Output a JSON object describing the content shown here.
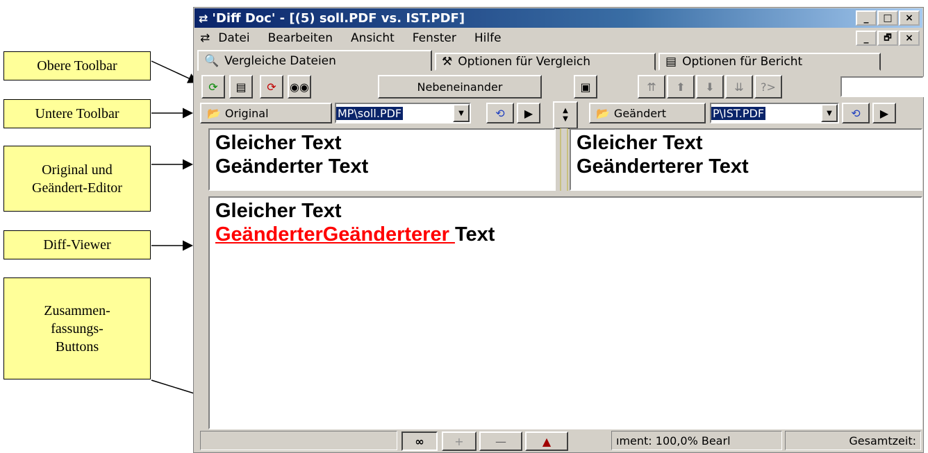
{
  "callouts": {
    "obere": "Obere Toolbar",
    "untere": "Untere Toolbar",
    "editor": "Original und\nGeändert-Editor",
    "viewer": "Diff-Viewer",
    "summary": "Zusammen-\nfassungs-\nButtons"
  },
  "window": {
    "title": "'Diff Doc' - [(5) soll.PDF vs. IST.PDF]",
    "controls": {
      "min": "_",
      "max": "□",
      "close": "×",
      "restore": "🗗"
    }
  },
  "menu": [
    "Datei",
    "Bearbeiten",
    "Ansicht",
    "Fenster",
    "Hilfe"
  ],
  "tabs": [
    "Vergleiche Dateien",
    "Optionen für Vergleich",
    "Optionen für Bericht"
  ],
  "toolbar": {
    "nebeneinander": "Nebeneinander"
  },
  "original": {
    "button": "Original",
    "path": "MP\\soll.PDF"
  },
  "changed": {
    "button": "Geändert",
    "path": "P\\IST.PDF"
  },
  "left_editor": {
    "line1": "Gleicher Text",
    "line2": "Geänderter Text"
  },
  "right_editor": {
    "line1": "Gleicher Text",
    "line2": "Geänderterer Text"
  },
  "diff": {
    "line1": "Gleicher Text",
    "changed": "GeänderterGeänderterer ",
    "rest": "Text"
  },
  "statusbar": {
    "summary_1": "∞",
    "summary_2": "+",
    "summary_3": "—",
    "summary_4": "▲",
    "doc": "ıment: 100,0% Bearl",
    "time": "Gesamtzeit:"
  },
  "colors": {
    "callout_bg": "#ffff99",
    "diff_changed": "#ff0000",
    "title_bar": "#0a246a"
  }
}
